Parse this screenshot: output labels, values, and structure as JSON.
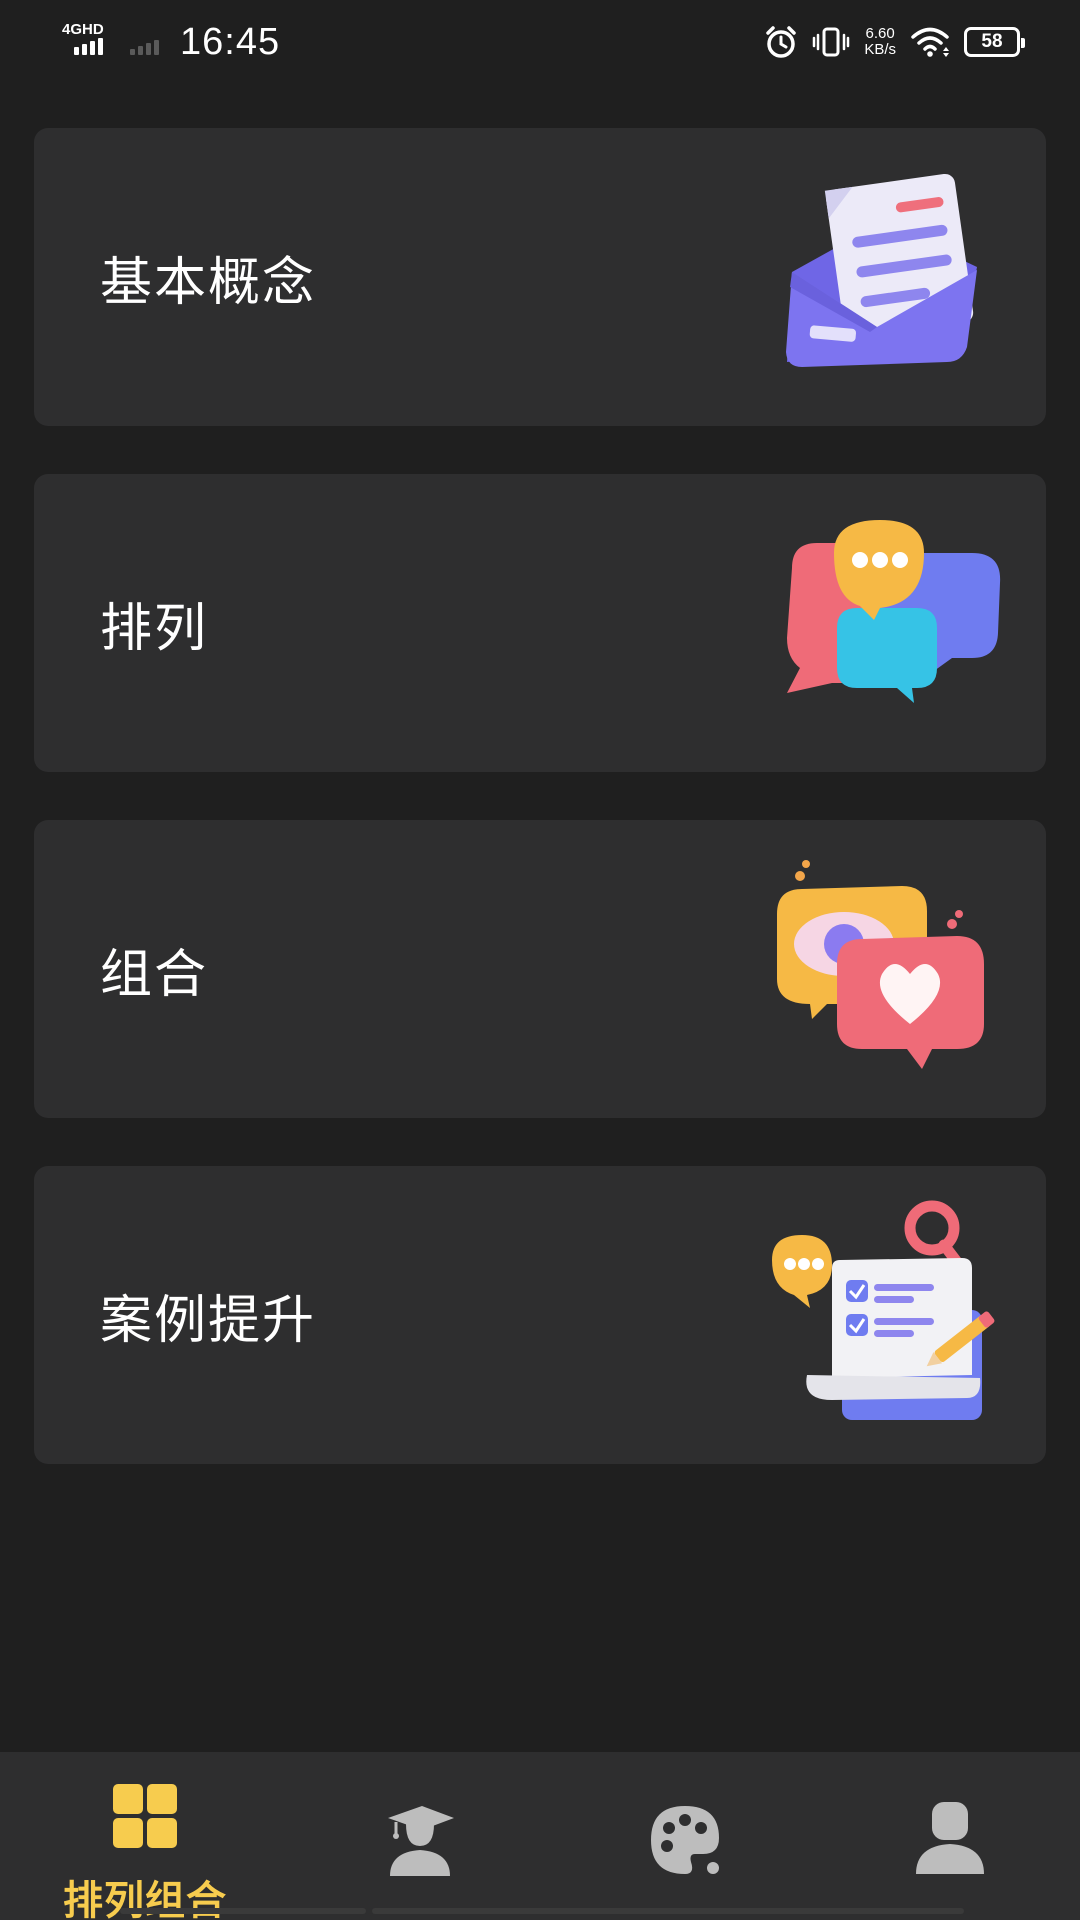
{
  "status_bar": {
    "network": "4GHD",
    "time": "16:45",
    "speed_value": "6.60",
    "speed_unit": "KB/s",
    "battery": "58"
  },
  "cards": [
    {
      "title": "基本概念",
      "icon": "envelope-letter-icon"
    },
    {
      "title": "排列",
      "icon": "chat-bubbles-icon"
    },
    {
      "title": "组合",
      "icon": "eye-heart-bubbles-icon"
    },
    {
      "title": "案例提升",
      "icon": "checklist-document-icon"
    }
  ],
  "bottom_nav": {
    "items": [
      {
        "label": "排列组合",
        "icon": "grid-icon",
        "active": true
      },
      {
        "label": "",
        "icon": "graduate-icon",
        "active": false
      },
      {
        "label": "",
        "icon": "palette-icon",
        "active": false
      },
      {
        "label": "",
        "icon": "person-icon",
        "active": false
      }
    ]
  },
  "colors": {
    "background": "#1f1f1f",
    "card": "#2e2e2f",
    "accent": "#f7cc4e",
    "inactive_icon": "#bdbdbd"
  }
}
